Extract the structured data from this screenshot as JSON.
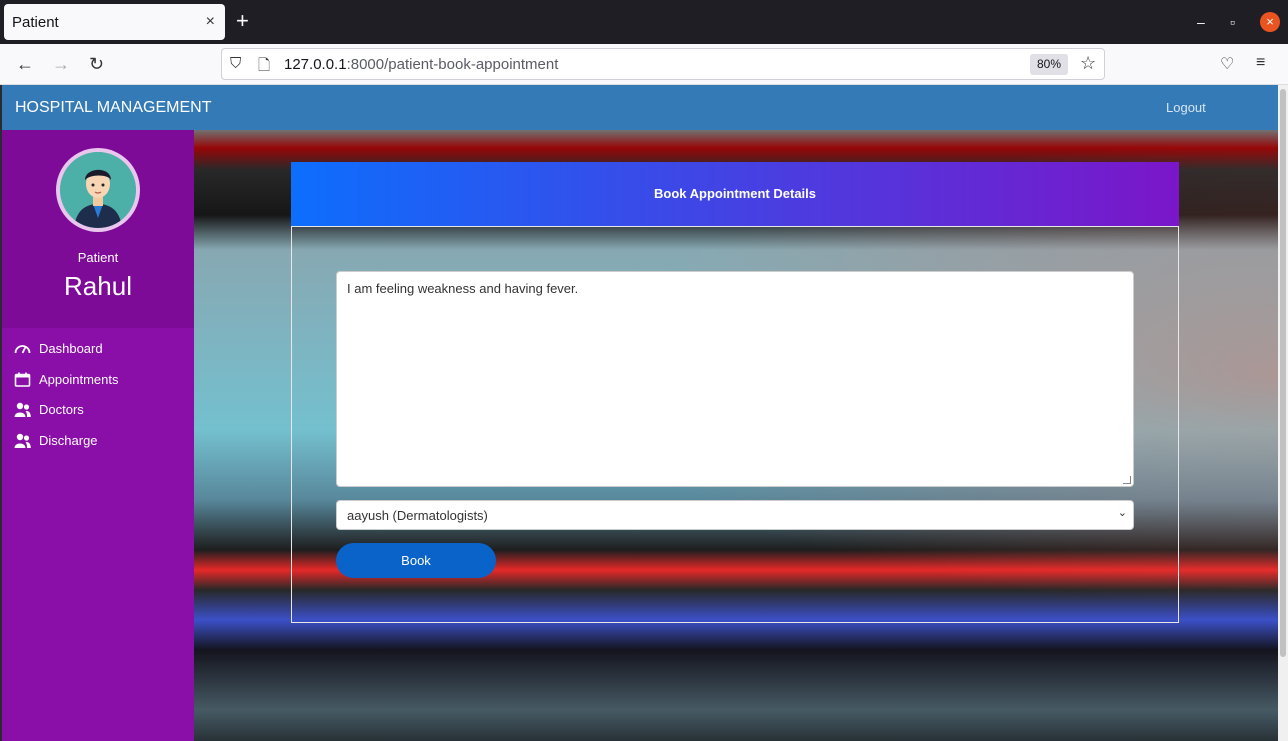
{
  "browser": {
    "tab_title": "Patient",
    "tab_close": "×",
    "new_tab": "+",
    "url_host": "127.0.0.1",
    "url_rest": ":8000/patient-book-appointment",
    "zoom": "80%",
    "window_controls": [
      "–",
      "▫",
      "×"
    ]
  },
  "app": {
    "brand": "HOSPITAL MANAGEMENT",
    "logout": "Logout"
  },
  "sidebar": {
    "role": "Patient",
    "name": "Rahul",
    "items": [
      {
        "label": "Dashboard",
        "icon": "speedometer-icon"
      },
      {
        "label": "Appointments",
        "icon": "calendar-icon"
      },
      {
        "label": "Doctors",
        "icon": "users-icon"
      },
      {
        "label": "Discharge",
        "icon": "users-icon"
      }
    ]
  },
  "form": {
    "title": "Book Appointment Details",
    "symptoms_value": "I am feeling weakness and having fever.",
    "doctor_selected": "aayush (Dermatologists)",
    "submit_label": "Book"
  },
  "colors": {
    "topnav": "#337ab7",
    "sidebar": "#8a0ea8",
    "button": "#0a63c9",
    "header_gradient_start": "#0d6efd",
    "header_gradient_end": "#7b16c9"
  }
}
